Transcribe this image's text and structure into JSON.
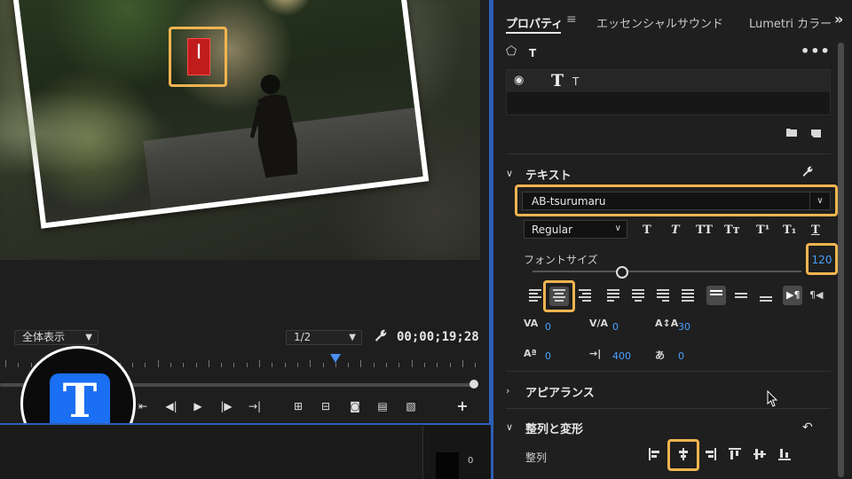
{
  "monitor": {
    "zoom_label": "全体表示",
    "resolution_label": "1/2",
    "timecode": "00;00;19;28",
    "meter_label": "0"
  },
  "panel": {
    "tabs": [
      {
        "label": "プロパティ",
        "active": true
      },
      {
        "label": "エッセンシャルサウンド",
        "active": false
      },
      {
        "label": "Lumetri カラー",
        "active": false
      }
    ],
    "layer_header_title": "T",
    "layers": [
      {
        "name": "T",
        "visible": true
      }
    ],
    "text_section": {
      "title": "テキスト",
      "font_family": "AB-tsurumaru",
      "font_style": "Regular",
      "font_size_label": "フォントサイズ",
      "font_size_value": "120",
      "font_size_slider_fraction": 0.33,
      "tracking_value": "0",
      "kerning_value": "0",
      "leading_value": "30",
      "baseline_shift_value": "0",
      "tab_width_value": "400",
      "tsume_value": "0"
    },
    "appearance_section": {
      "title": "アピアランス"
    },
    "transform_section": {
      "title": "整列と変形",
      "align_label": "整列"
    }
  },
  "colors": {
    "accent_highlight": "#f2b450",
    "link_blue": "#4aa0ff",
    "panel_focus_border": "#2d5fb8",
    "app_icon_blue": "#1a6ff2"
  }
}
